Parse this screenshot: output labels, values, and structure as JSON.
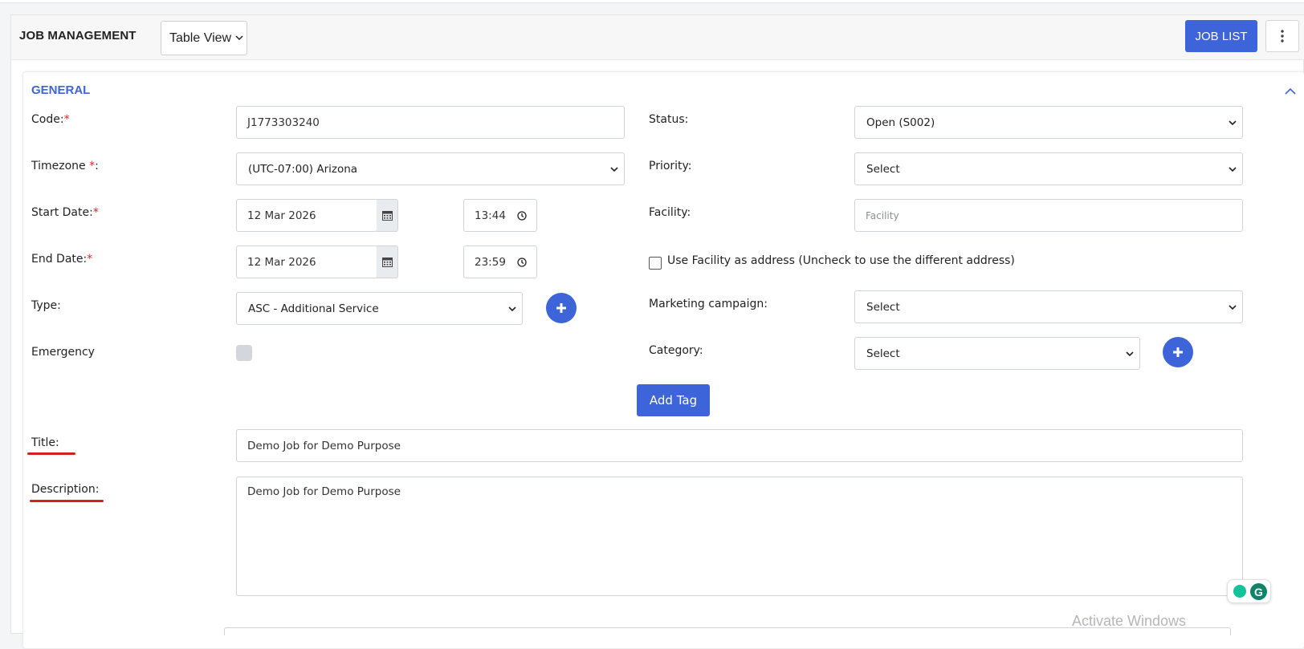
{
  "header": {
    "title": "JOB MANAGEMENT",
    "view_select": "Table View",
    "job_list_label": "JOB LIST"
  },
  "section": {
    "title": "GENERAL"
  },
  "form": {
    "code": {
      "label": "Code:",
      "required_mark": "*",
      "value": "J1773303240"
    },
    "timezone": {
      "label": "Timezone ",
      "required_mark": "*",
      "label_suffix": ":",
      "value": "(UTC-07:00) Arizona"
    },
    "start_date": {
      "label": "Start Date:",
      "required_mark": "*",
      "date": "12 Mar 2026",
      "time": "13:44"
    },
    "end_date": {
      "label": "End Date:",
      "required_mark": "*",
      "date": "12 Mar 2026",
      "time": "23:59"
    },
    "type": {
      "label": "Type:",
      "value": "ASC - Additional Service"
    },
    "emergency": {
      "label": "Emergency"
    },
    "status": {
      "label": "Status:",
      "value": "Open (S002)"
    },
    "priority": {
      "label": "Priority:",
      "value": "Select"
    },
    "facility": {
      "label": "Facility:",
      "placeholder": "Facility"
    },
    "use_facility": {
      "label": "Use Facility as address (Uncheck to use the different address)",
      "checked": false
    },
    "marketing_campaign": {
      "label": "Marketing campaign:",
      "value": "Select"
    },
    "category": {
      "label": "Category:",
      "value": "Select"
    },
    "add_tag_label": "Add Tag",
    "title": {
      "label": "Title:",
      "value": "Demo Job for Demo Purpose"
    },
    "description": {
      "label": "Description:",
      "value": "Demo Job for Demo Purpose"
    }
  },
  "watermark": "Activate Windows",
  "colors": {
    "accent": "#3d64d8",
    "required": "#d92a2a",
    "annotation": "#d62020"
  },
  "icons": [
    "chevron-down-icon",
    "kebab-icon",
    "chevron-up-icon",
    "calendar-icon",
    "clock-icon",
    "plus-icon",
    "grammarly-icon"
  ]
}
